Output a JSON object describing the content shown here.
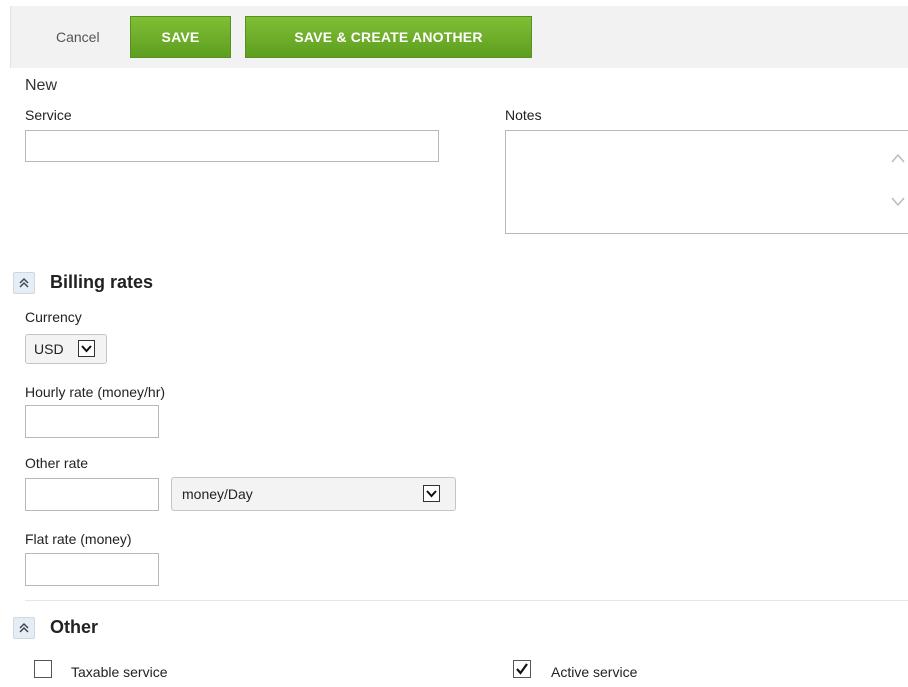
{
  "toolbar": {
    "cancel_label": "Cancel",
    "save_label": "SAVE",
    "save_create_label": "SAVE & CREATE ANOTHER",
    "button_color": "#6cae2a"
  },
  "form": {
    "title": "New",
    "service_label": "Service",
    "service_value": "",
    "notes_label": "Notes",
    "notes_value": ""
  },
  "billing": {
    "section_title": "Billing rates",
    "currency_label": "Currency",
    "currency_value": "USD",
    "hourly_label": "Hourly rate (money/hr)",
    "hourly_value": "",
    "other_label": "Other rate",
    "other_value": "",
    "other_unit_value": "money/Day",
    "flat_label": "Flat rate (money)",
    "flat_value": ""
  },
  "other": {
    "section_title": "Other",
    "taxable_label": "Taxable service",
    "taxable_checked": false,
    "active_label": "Active service",
    "active_checked": true
  }
}
